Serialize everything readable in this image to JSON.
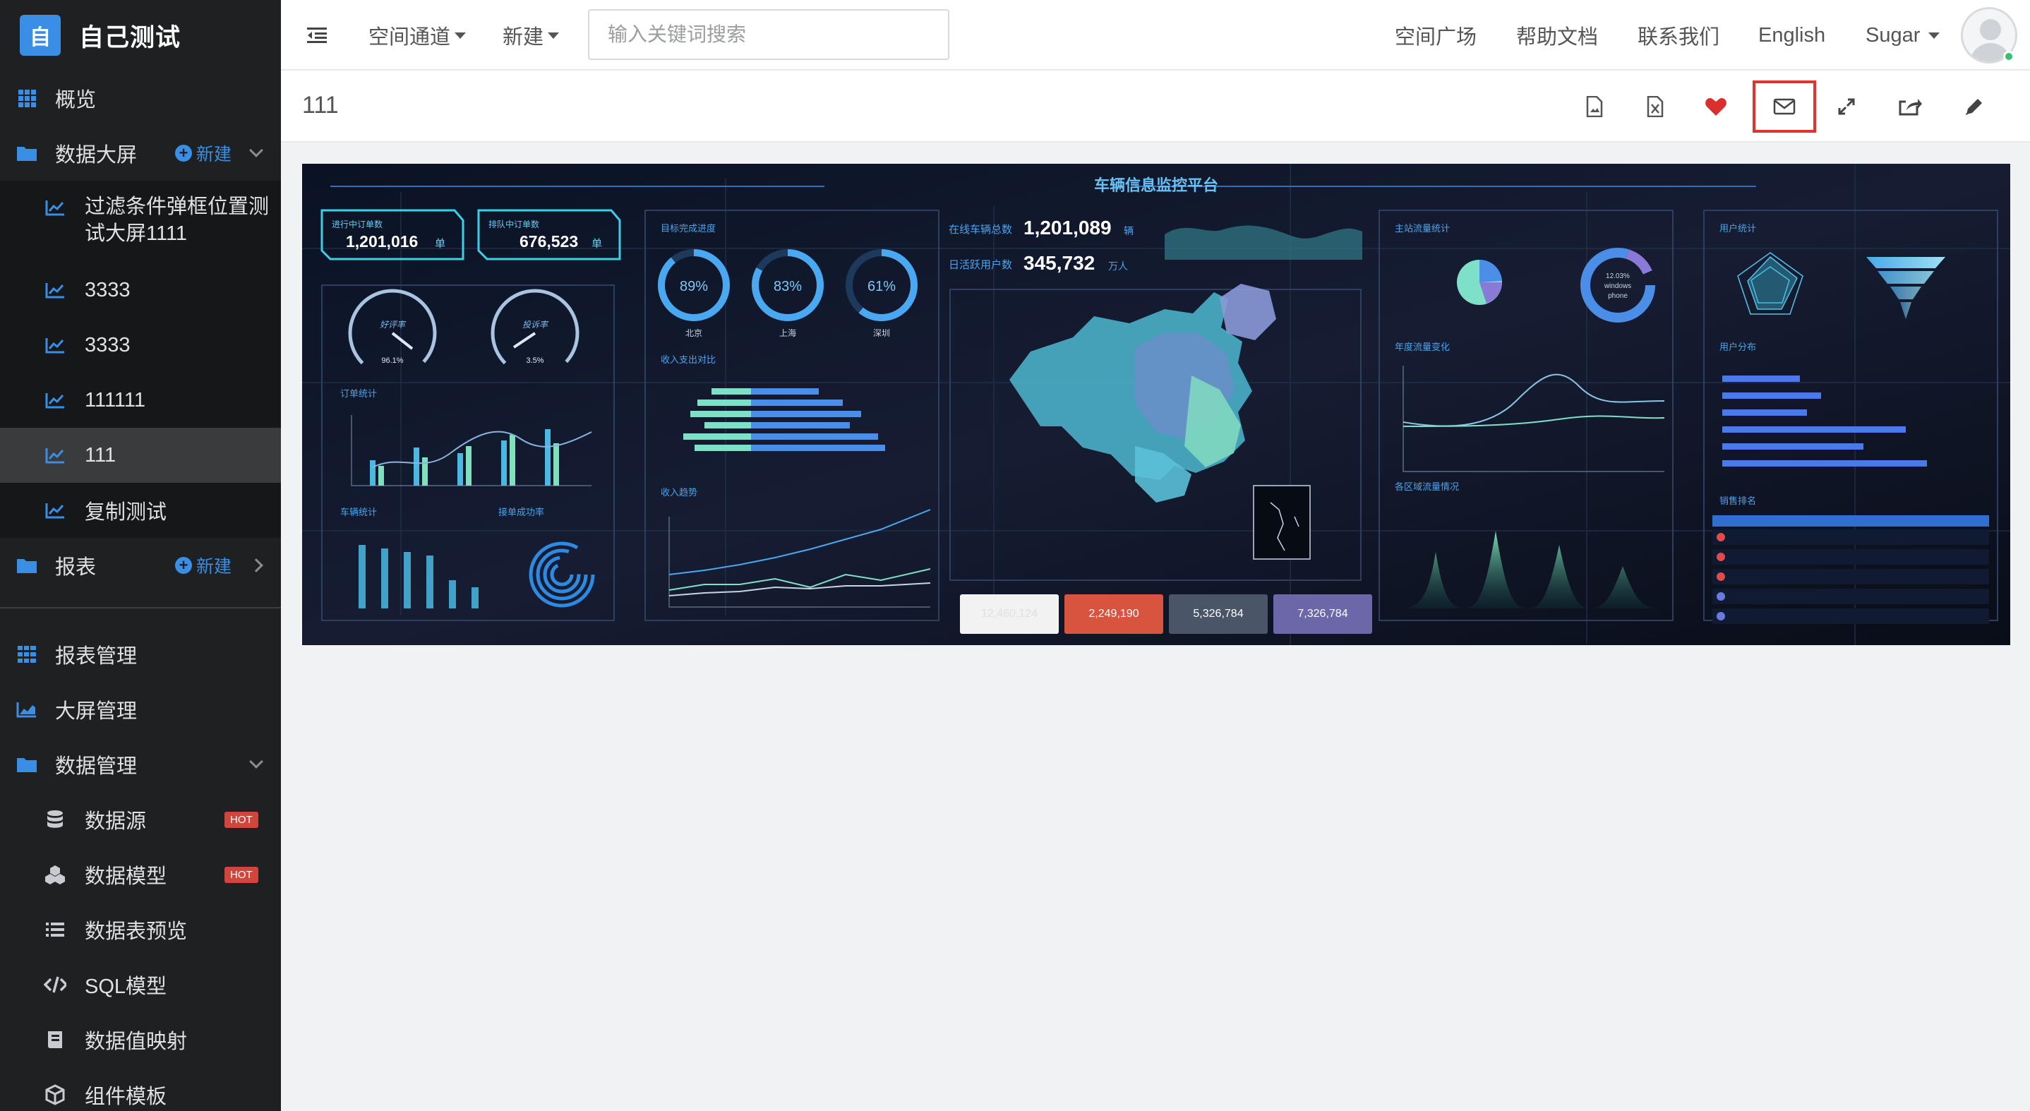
{
  "brand": {
    "logo_char": "自",
    "title": "自己测试"
  },
  "sidebar": {
    "items": [
      {
        "label": "概览",
        "icon": "dashboard-grid-icon"
      },
      {
        "label": "数据大屏",
        "icon": "folder-icon",
        "new_label": "新建"
      },
      {
        "label": "过滤条件弹框位置测",
        "label2": "试大屏1111",
        "icon": "chart-line-icon"
      },
      {
        "label": "3333",
        "icon": "chart-line-icon"
      },
      {
        "label": "3333",
        "icon": "chart-line-icon"
      },
      {
        "label": "111111",
        "icon": "chart-line-icon"
      },
      {
        "label": "111",
        "icon": "chart-line-icon"
      },
      {
        "label": "复制测试",
        "icon": "chart-line-icon"
      },
      {
        "label": "报表",
        "icon": "folder-icon",
        "new_label": "新建"
      },
      {
        "label": "报表管理",
        "icon": "grid-icon"
      },
      {
        "label": "大屏管理",
        "icon": "chart-area-icon"
      },
      {
        "label": "数据管理",
        "icon": "folder-icon"
      },
      {
        "label": "数据源",
        "icon": "database-icon",
        "badge": "HOT"
      },
      {
        "label": "数据模型",
        "icon": "cubes-icon",
        "badge": "HOT"
      },
      {
        "label": "数据表预览",
        "icon": "list-icon"
      },
      {
        "label": "SQL模型",
        "icon": "code-icon"
      },
      {
        "label": "数据值映射",
        "icon": "book-icon"
      },
      {
        "label": "组件模板",
        "icon": "cube-icon"
      }
    ]
  },
  "topbar": {
    "space_channel": "空间通道",
    "new": "新建",
    "search_placeholder": "输入关键词搜索",
    "links": [
      "空间广场",
      "帮助文档",
      "联系我们",
      "English"
    ],
    "user": "Sugar"
  },
  "page": {
    "title": "111"
  },
  "actions": [
    "export-image-icon",
    "export-excel-icon",
    "favorite-heart-icon",
    "email-subscribe-icon",
    "fullscreen-icon",
    "share-icon",
    "edit-pencil-icon"
  ],
  "dashboard": {
    "title": "车辆信息监控平台",
    "orders": [
      {
        "label": "进行中订单数",
        "value": "1,201,016",
        "unit": "单"
      },
      {
        "label": "排队中订单数",
        "value": "676,523",
        "unit": "单"
      }
    ],
    "gauges": [
      {
        "label": "好评率",
        "value": "96.1%"
      },
      {
        "label": "投诉率",
        "value": "3.5%"
      }
    ],
    "section_titles": [
      "订单统计",
      "车辆统计",
      "接单成功率",
      "目标完成进度",
      "收入支出对比",
      "收入趋势",
      "主站流量统计",
      "年度流量变化",
      "各区域流量情况",
      "用户统计",
      "用户分布",
      "销售排名"
    ],
    "progress": [
      {
        "city": "北京",
        "value": "89%"
      },
      {
        "city": "上海",
        "value": "83%"
      },
      {
        "city": "深圳",
        "value": "61%"
      }
    ],
    "online_label": "在线车辆总数",
    "online_value": "1,201,089",
    "online_unit": "辆",
    "dau_label": "日活跃用户数",
    "dau_value": "345,732",
    "dau_unit": "万人",
    "pie_center": [
      "12.03%",
      "windows",
      "phone"
    ],
    "kpis": [
      {
        "value": "12,460,124",
        "color": "#f2f2f2",
        "text": "#e0e0e0"
      },
      {
        "value": "2,249,190",
        "color": "#d9543f",
        "text": "#ffffff"
      },
      {
        "value": "5,326,784",
        "color": "#4a5568",
        "text": "#ffffff"
      },
      {
        "value": "7,326,784",
        "color": "#6b67a8",
        "text": "#ffffff"
      }
    ]
  }
}
